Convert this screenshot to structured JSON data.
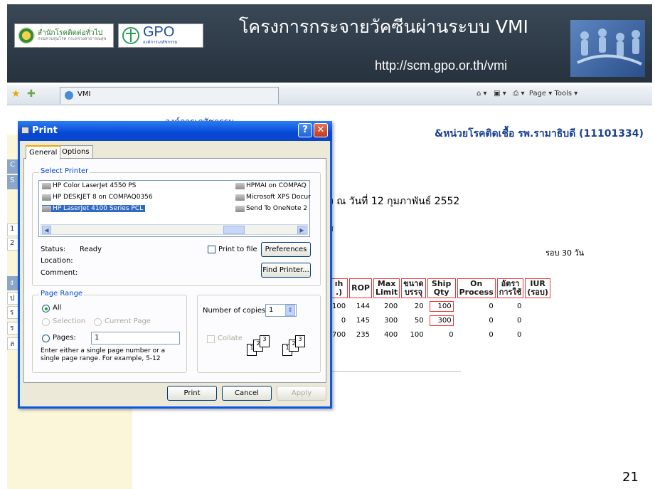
{
  "banner": {
    "logo1_text": "สำนักโรคติดต่อทั่วไป",
    "logo1_sub": "กรมควบคุมโรค กระทรวงสาธารณสุข",
    "logo2_text": "GPO",
    "logo2_sub": "องค์การเภสัชกรรม",
    "title": "โครงการกระจายวัคซีนผ่านระบบ VMI",
    "url": "http://scm.gpo.or.th/vmi"
  },
  "browser": {
    "tab_label": "VMI",
    "toolbar_right": "Page ▾   Tools ▾"
  },
  "page": {
    "org": "องค์การเภสัชกรรม",
    "hospital": "&หน่วยโรคติดเชื้อ รพ.รามาธิบดี (11101334)",
    "date_line": "ง ณ วันที่  12 กุมภาพันธ์ 2552",
    "small_mark": "ส",
    "round_label": "รอบ 30 วัน",
    "page_number": "21",
    "left_labels": [
      "C",
      "S",
      "1",
      "2",
      "ง",
      "ป",
      "ร",
      "ร",
      "ล"
    ],
    "table": {
      "headers": [
        "ıh\n.)",
        "ROP",
        "Max\nLimit",
        "ขนาด\nบรรจุ",
        "Ship\nQty",
        "On\nProcess",
        "อัตรา\nการใช้",
        "IUR\n(รอบ)"
      ],
      "rows": [
        [
          "100",
          "144",
          "200",
          "20",
          "100",
          "0",
          "0",
          ""
        ],
        [
          "0",
          "145",
          "300",
          "50",
          "300",
          "0",
          "0",
          ""
        ],
        [
          "700",
          "235",
          "400",
          "100",
          "0",
          "0",
          "0",
          ""
        ]
      ]
    }
  },
  "dialog": {
    "title": "Print",
    "help": "?",
    "close": "✕",
    "tabs": [
      "General",
      "Options"
    ],
    "select_printer_label": "Select Printer",
    "printers_left": [
      "HP Color LaserJet 4550 PS",
      "HP DESKJET 8 on COMPAQ0356",
      "HP LaserJet 4100 Series PCL"
    ],
    "printers_right": [
      "HPMAI on COMPAQ",
      "Microsoft XPS Docur",
      "Send To OneNote 2"
    ],
    "status_label": "Status:",
    "status_value": "Ready",
    "location_label": "Location:",
    "comment_label": "Comment:",
    "print_to_file": "Print to file",
    "preferences": "Preferences",
    "find_printer": "Find Printer...",
    "page_range_label": "Page Range",
    "all": "All",
    "selection": "Selection",
    "current_page": "Current Page",
    "pages": "Pages:",
    "pages_value": "1",
    "range_help": "Enter either a single page number or a single page range.  For example, 5-12",
    "copies_label": "Number of copies:",
    "copies_value": "1",
    "collate": "Collate",
    "print_btn": "Print",
    "cancel_btn": "Cancel",
    "apply_btn": "Apply"
  }
}
